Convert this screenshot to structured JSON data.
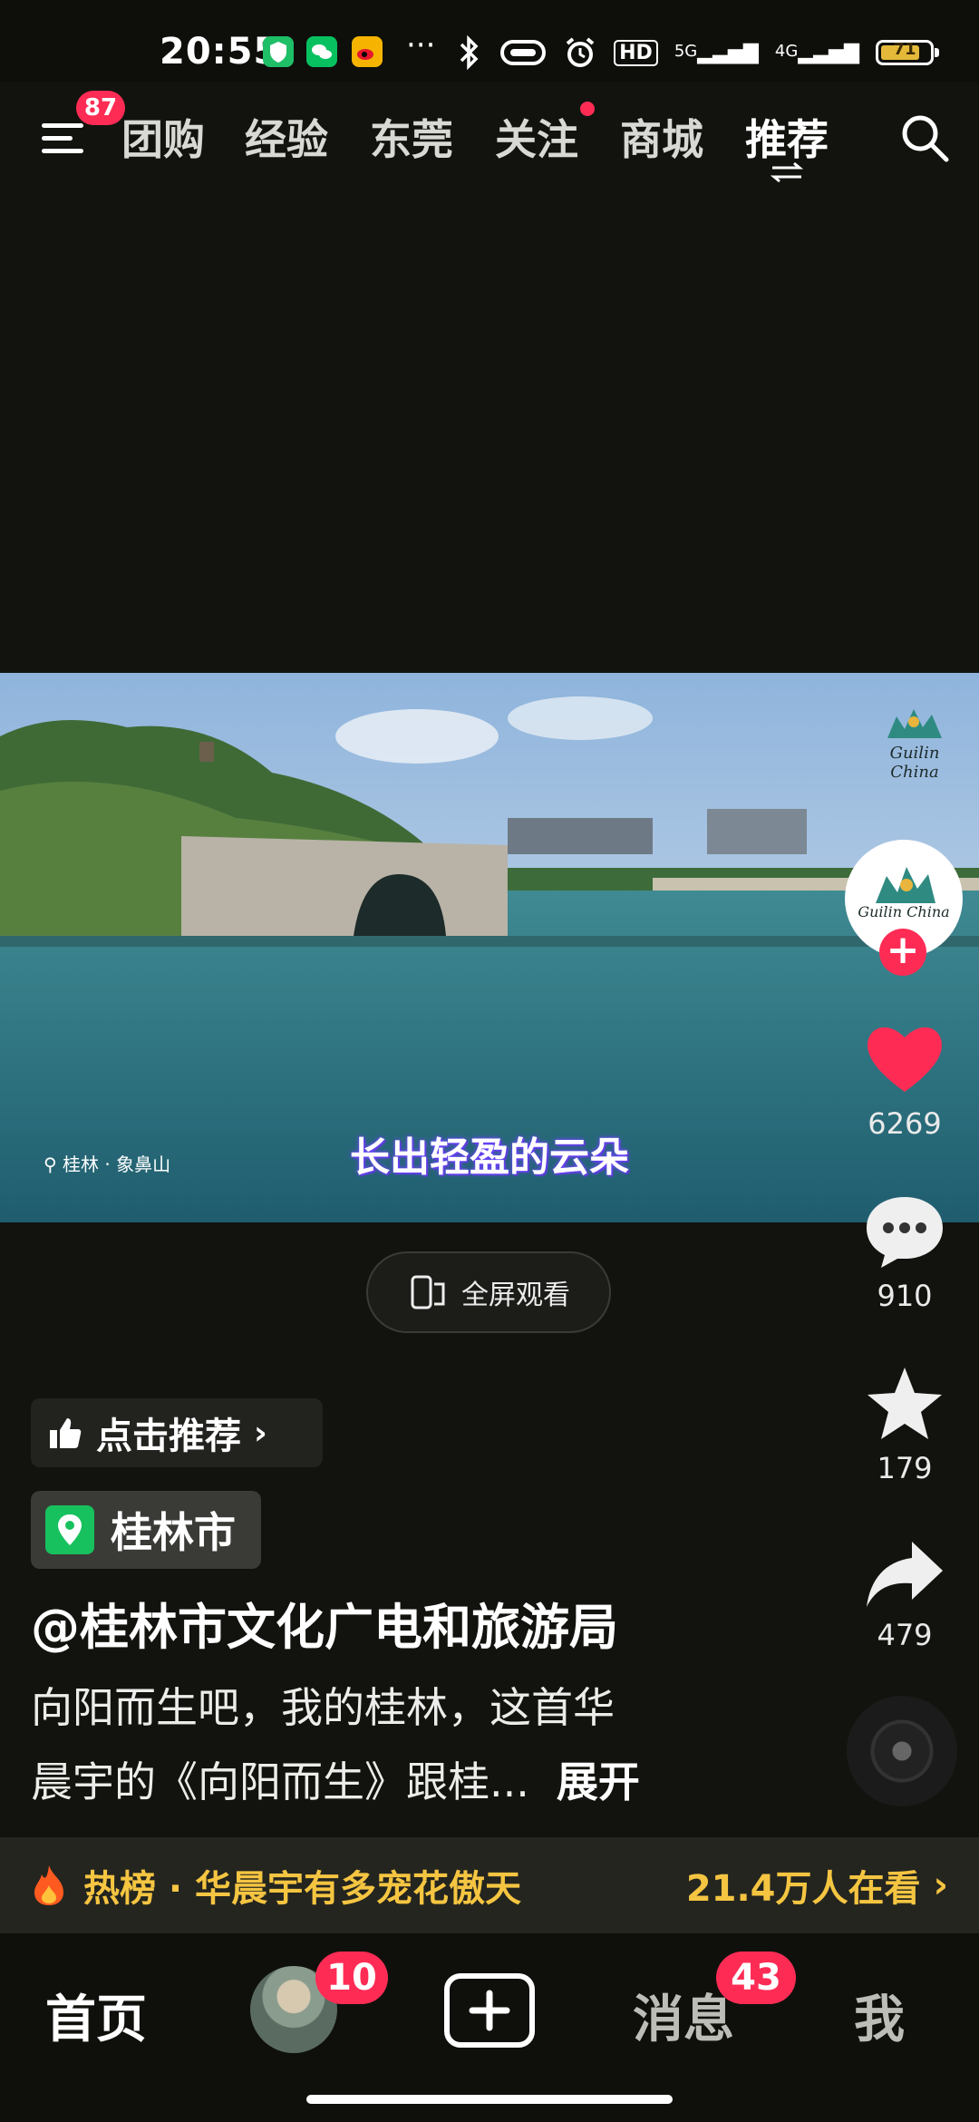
{
  "status": {
    "time": "20:55",
    "hd": "HD",
    "net1": "5G",
    "net2": "4G",
    "battery": "71",
    "more": "···"
  },
  "nav": {
    "menu_badge": "87",
    "tabs": [
      "团购",
      "经验",
      "东莞",
      "关注",
      "商城",
      "推荐"
    ]
  },
  "video": {
    "watermark": "Guilin China",
    "caption": "长出轻盈的云朵",
    "location_tag": "桂林 · 象鼻山"
  },
  "fullscreen_label": "全屏观看",
  "rail": {
    "avatar_text": "Guilin China",
    "likes": "6269",
    "comments": "910",
    "favorites": "179",
    "shares": "479"
  },
  "recommend_label": "点击推荐",
  "location_label": "桂林市",
  "author": "@桂林市文化广电和旅游局",
  "description": {
    "line1": "向阳而生吧，我的桂林，这首华",
    "line2": "晨宇的《向阳而生》跟桂...",
    "more": "展开"
  },
  "hot": {
    "label": "热榜 · 华晨宇有多宠花傲天",
    "viewers": "21.4万人在看"
  },
  "bottom_nav": {
    "home": "首页",
    "friends_badge": "10",
    "messages": "消息",
    "messages_badge": "43",
    "me": "我"
  },
  "colors": {
    "accent": "#fe2c55",
    "hot": "#f5c542",
    "background": "#12130e"
  }
}
